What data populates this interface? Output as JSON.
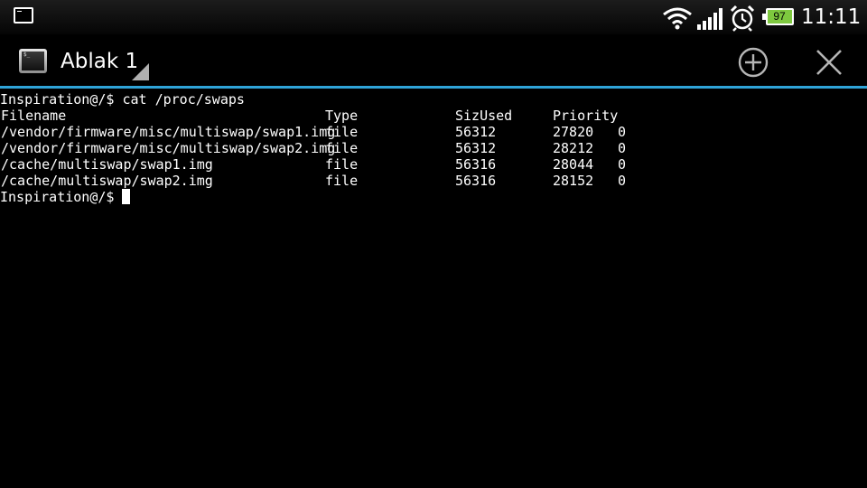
{
  "status_bar": {
    "time": "11:11",
    "battery_level": "97",
    "icons": [
      "terminal-notification-icon",
      "wifi-icon",
      "signal-icon",
      "alarm-icon",
      "battery-icon"
    ]
  },
  "action_bar": {
    "title": "Ablak 1",
    "app_icon": "terminal-app-icon",
    "actions": [
      "plus-circle-icon",
      "close-icon"
    ],
    "accent_color": "#2fa3d8"
  },
  "terminal": {
    "command_line": {
      "prompt": "Inspiration@/$",
      "command": " cat /proc/swaps"
    },
    "header": {
      "filename": "Filename",
      "type": "Type",
      "size_used": "SizUsed",
      "priority": "Priority"
    },
    "rows": [
      {
        "filename": "/vendor/firmware/misc/multiswap/swap1.img",
        "type": "file",
        "size": "56312",
        "used": "27820",
        "priority": "0"
      },
      {
        "filename": "/vendor/firmware/misc/multiswap/swap2.img",
        "type": "file",
        "size": "56312",
        "used": "28212",
        "priority": "0"
      },
      {
        "filename": "/cache/multiswap/swap1.img",
        "type": "file",
        "size": "56316",
        "used": "28044",
        "priority": "0"
      },
      {
        "filename": "/cache/multiswap/swap2.img",
        "type": "file",
        "size": "56316",
        "used": "28152",
        "priority": "0"
      }
    ],
    "final_prompt": "Inspiration@/$"
  }
}
